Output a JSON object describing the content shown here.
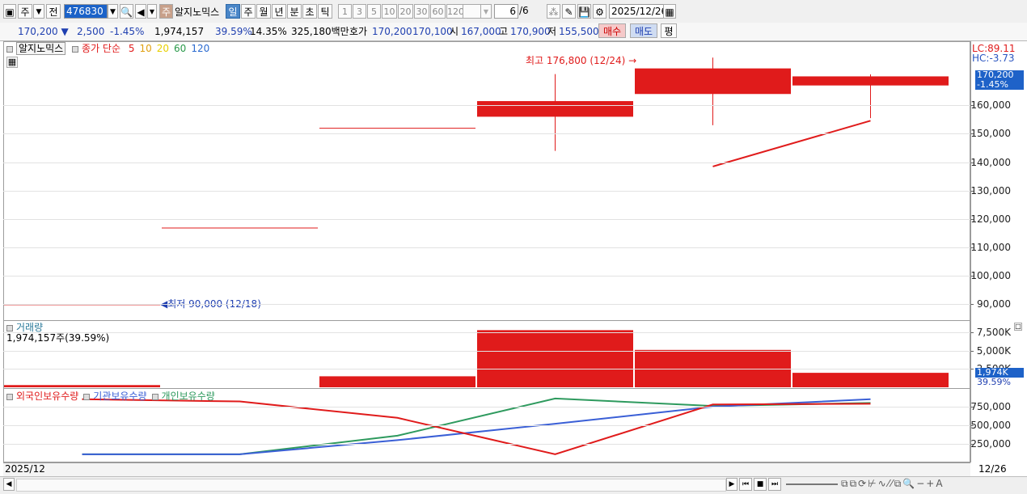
{
  "toolbar": {
    "mode_label": "주",
    "prev_label": "전",
    "stock_code": "476830",
    "stock_badge": "주",
    "stock_name": "알지노믹스",
    "periods": [
      "일",
      "주",
      "월",
      "년",
      "분",
      "초",
      "틱"
    ],
    "selected_period": "일",
    "intervals": [
      "1",
      "3",
      "5",
      "10",
      "20",
      "30",
      "60",
      "120"
    ],
    "count_display": "6",
    "count_total": "/6",
    "date_value": "2025/12/26"
  },
  "quote": {
    "price": "170,200",
    "arrow": "▼",
    "change": "2,500",
    "change_pct": "-1.45%",
    "volume": "1,974,157",
    "ratio1": "39.59%",
    "ratio2": "14.35%",
    "amount": "325,180백만",
    "hoga_label": "호가",
    "ask": "170,200",
    "bid": "170,100",
    "open_label": "시",
    "open": "167,000",
    "high_label": "고",
    "high": "170,900",
    "low_label": "저",
    "low": "155,500",
    "buy_label": "매수",
    "sell_label": "매도",
    "eval_label": "평"
  },
  "price_panel": {
    "stock_tag": "알지노믹스",
    "ma_label": "종가 단순",
    "ma_periods": [
      {
        "label": "5",
        "color": "#e01b1b"
      },
      {
        "label": "10",
        "color": "#e0a010"
      },
      {
        "label": "20",
        "color": "#e8d000"
      },
      {
        "label": "60",
        "color": "#2a9a4a"
      },
      {
        "label": "120",
        "color": "#2a6ad0"
      }
    ],
    "lc_text": "LC:89.11",
    "hc_text": "HC:-3.73",
    "high_annotation": "최고 176,800 (12/24)",
    "low_annotation": "최저 90,000 (12/18)",
    "current_price_tag": "170,200",
    "current_pct_tag": "-1.45%",
    "y_ticks": [
      "160,000",
      "150,000",
      "140,000",
      "130,000",
      "120,000",
      "110,000",
      "100,000",
      "90,000"
    ]
  },
  "volume_panel": {
    "title": "거래량",
    "value_text": "1,974,157주(39.59%)",
    "y_ticks": [
      "7,500K",
      "5,000K",
      "2,500K"
    ],
    "current_tag": "1,974K",
    "current_pct": "39.59%"
  },
  "holdings_panel": {
    "legend": [
      {
        "label": "외국인보유수량",
        "color": "#e01b1b"
      },
      {
        "label": "기관보유수량",
        "color": "#3a5fd6"
      },
      {
        "label": "개인보유수량",
        "color": "#2e9a5e"
      }
    ],
    "y_ticks": [
      "750,000",
      "500,000",
      "250,000"
    ]
  },
  "footer": {
    "start_label": "2025/12",
    "end_label": "12/26"
  },
  "chart_data": {
    "type": "candlestick",
    "dates_visible": [
      "2025/12",
      "12/26"
    ],
    "candles": [
      {
        "open": 90000,
        "high": 90000,
        "low": 90000,
        "close": 90000,
        "color": "#e01b1b"
      },
      {
        "open": 117000,
        "high": 117000,
        "low": 117000,
        "close": 117000,
        "color": "#e01b1b"
      },
      {
        "open": 152100,
        "high": 152100,
        "low": 152100,
        "close": 152100,
        "color": "#e01b1b"
      },
      {
        "open": 156000,
        "high": 171000,
        "low": 144000,
        "close": 161500,
        "color": "#e01b1b"
      },
      {
        "open": 164000,
        "high": 176800,
        "low": 153000,
        "close": 173000,
        "color": "#e01b1b"
      },
      {
        "open": 167000,
        "high": 170900,
        "low": 155500,
        "close": 170200,
        "color": "#e01b1b"
      }
    ],
    "ma5": [
      null,
      null,
      null,
      null,
      138500,
      154600
    ],
    "volume": [
      300000,
      0,
      1500000,
      7800000,
      5100000,
      1974157
    ],
    "holdings": {
      "foreign": [
        850000,
        820000,
        600000,
        110000,
        780000,
        790000
      ],
      "institution": [
        110000,
        110000,
        300000,
        520000,
        750000,
        850000
      ],
      "individual": [
        110000,
        110000,
        360000,
        860000,
        760000,
        800000
      ]
    },
    "price_ylim": [
      85000,
      180000
    ],
    "volume_ylim": [
      0,
      8500000
    ],
    "holdings_ylim": [
      0,
      1000000
    ]
  }
}
